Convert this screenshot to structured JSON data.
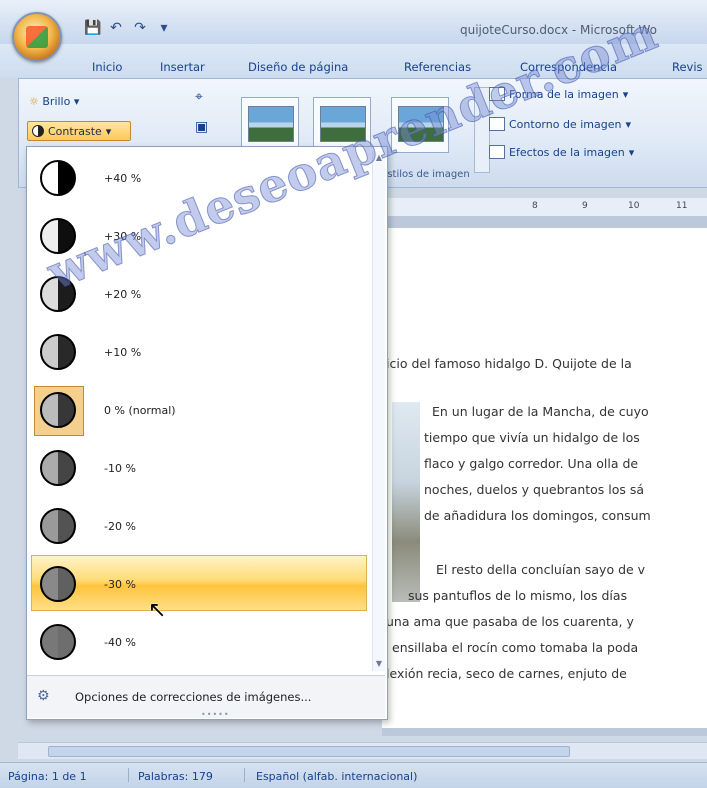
{
  "window": {
    "title": "quijoteCurso.docx - Microsoft Wo"
  },
  "quick_access": {
    "icons": [
      "save-icon",
      "undo-icon",
      "redo-icon",
      "customize-icon"
    ]
  },
  "tabs": [
    {
      "label": "Inicio"
    },
    {
      "label": "Insertar"
    },
    {
      "label": "Diseño de página"
    },
    {
      "label": "Referencias"
    },
    {
      "label": "Correspondencia"
    },
    {
      "label": "Revis"
    }
  ],
  "ribbon": {
    "brightness_label": "Brillo",
    "contrast_label": "Contraste",
    "styles_group_label": "Estilos de imagen",
    "picture_shape_label": "Forma de la imagen",
    "picture_border_label": "Contorno de imagen",
    "picture_effects_label": "Efectos de la imagen"
  },
  "contrast_menu": {
    "options": [
      {
        "label": "+40 %",
        "level": 40
      },
      {
        "label": "+30 %",
        "level": 30
      },
      {
        "label": "+20 %",
        "level": 20
      },
      {
        "label": "+10 %",
        "level": 10
      },
      {
        "label": "0 % (normal)",
        "level": 0,
        "selected": true
      },
      {
        "label": "-10 %",
        "level": -10
      },
      {
        "label": "-20 %",
        "level": -20
      },
      {
        "label": "-30 %",
        "level": -30,
        "hovered": true
      },
      {
        "label": "-40 %",
        "level": -40
      }
    ],
    "footer_label": "Opciones de correcciones de imágenes..."
  },
  "ruler": {
    "marks": [
      "8",
      "9",
      "10",
      "11"
    ]
  },
  "document": {
    "lines": [
      "icio del famoso hidalgo D. Quijote de la",
      "En un lugar de la Mancha, de cuyo",
      "tiempo que vivía un hidalgo de los",
      "flaco y galgo corredor. Una olla de",
      "noches, duelos y quebrantos los sá",
      "de añadidura los domingos, consum",
      "El resto della concluían sayo de v",
      "sus pantuflos de lo mismo, los días",
      "una ama que pasaba de los cuarenta, y",
      "ensillaba el rocín como tomaba la poda",
      "lexión recia, seco de carnes, enjuto de"
    ]
  },
  "status": {
    "page": "Página: 1 de 1",
    "words": "Palabras: 179",
    "language": "Español (alfab. internacional)"
  },
  "watermark": "www.deseoaprender.com"
}
